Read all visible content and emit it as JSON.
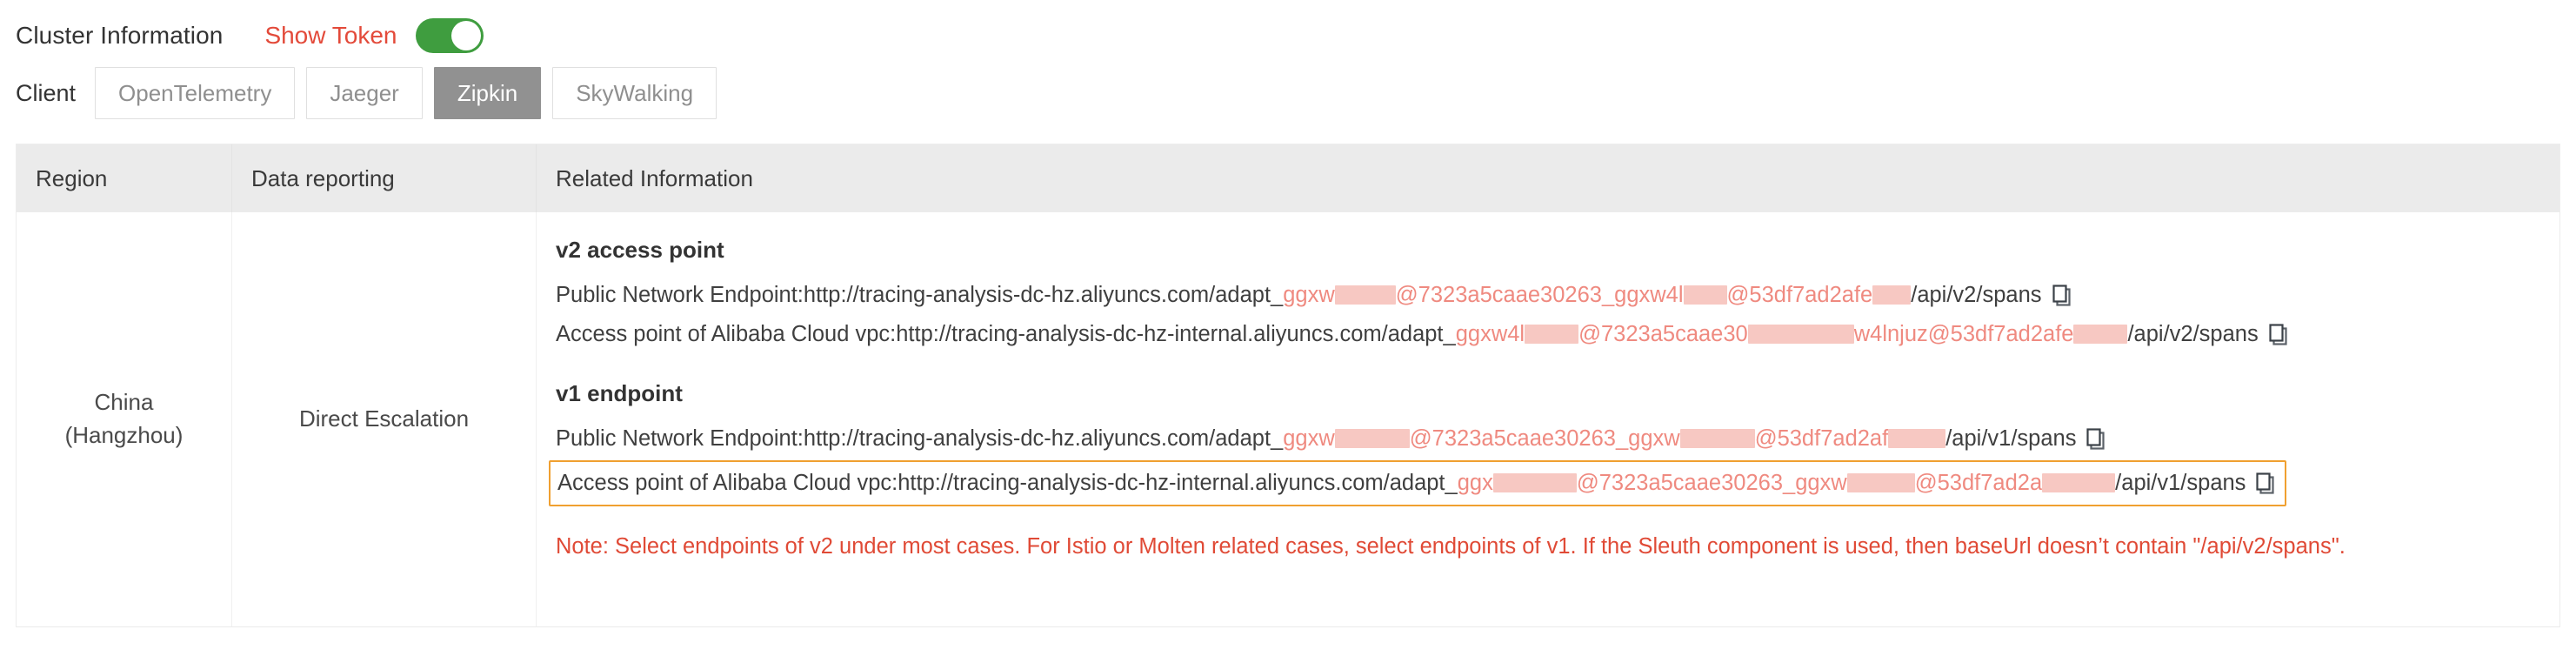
{
  "header": {
    "title": "Cluster Information",
    "show_token_label": "Show Token",
    "toggle_state": "on",
    "accent_red": "#e34a3a",
    "toggle_green": "#3f9d3f"
  },
  "client": {
    "label": "Client",
    "options": [
      "OpenTelemetry",
      "Jaeger",
      "Zipkin",
      "SkyWalking"
    ],
    "selected": "Zipkin"
  },
  "table": {
    "columns": [
      "Region",
      "Data reporting",
      "Related Information"
    ],
    "row": {
      "region": "China\n(Hangzhou)",
      "region_line1": "China",
      "region_line2": "(Hangzhou)",
      "data_reporting": "Direct Escalation"
    }
  },
  "related": {
    "v2_group_title": "v2 access point",
    "v1_group_title": "v1 endpoint",
    "endpoints": [
      {
        "group": "v2",
        "label": "Public Network Endpoint:",
        "base_url": "http://tracing-analysis-dc-hz.aliyuncs.com/adapt_",
        "token_part1": "ggxw",
        "token_redacted1": "████",
        "token_part2": "@7323a5caae30263_ggxw4l",
        "token_redacted2": "███",
        "token_part3": "@53df7ad2afe",
        "token_redacted3": "███",
        "suffix": "/api/v2/spans",
        "copy_icon": "copy-icon",
        "highlighted": false
      },
      {
        "group": "v2",
        "label": "Access point of Alibaba Cloud vpc:",
        "base_url": "http://tracing-analysis-dc-hz-internal.aliyuncs.com/adapt_",
        "token_part1": "ggxw4l",
        "token_redacted1": "███",
        "token_part2": "@7323a5caae30",
        "token_redacted2": "█████",
        "token_part3": "w4lnjuz@53df7ad2afe",
        "token_redacted3": "████",
        "suffix": "/api/v2/spans",
        "copy_icon": "copy-icon",
        "highlighted": false
      },
      {
        "group": "v1",
        "label": "Public Network Endpoint:",
        "base_url": "http://tracing-analysis-dc-hz.aliyuncs.com/adapt_",
        "token_part1": "ggxw",
        "token_redacted1": "█████",
        "token_part2": "@7323a5caae30263_ggxw",
        "token_redacted2": "█████",
        "token_part3": "@53df7ad2af",
        "token_redacted3": "████",
        "suffix": "/api/v1/spans",
        "copy_icon": "copy-icon",
        "highlighted": false
      },
      {
        "group": "v1",
        "label": "Access point of Alibaba Cloud vpc:",
        "base_url": "http://tracing-analysis-dc-hz-internal.aliyuncs.com/adapt_",
        "token_part1": "ggx",
        "token_redacted1": "█████",
        "token_part2": "@7323a5caae30263_ggxw",
        "token_redacted2": "████",
        "token_part3": "@53df7ad2a",
        "token_redacted3": "█████",
        "suffix": "/api/v1/spans",
        "copy_icon": "copy-icon",
        "highlighted": true
      }
    ],
    "note": "Note: Select endpoints of v2 under most cases. For Istio or Molten related cases, select endpoints of v1. If the Sleuth component is used, then baseUrl doesn’t contain \"/api/v2/spans\".",
    "note_color": "#e04a36",
    "highlight_border_color": "#f0a030"
  }
}
